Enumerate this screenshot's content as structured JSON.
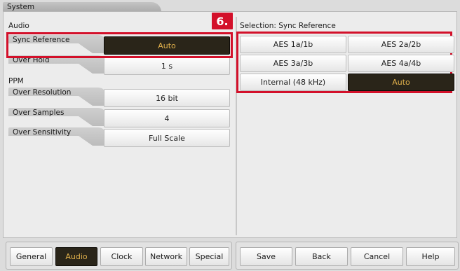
{
  "window": {
    "title": "System"
  },
  "left": {
    "audio_label": "Audio",
    "ppm_label": "PPM",
    "rows": [
      {
        "label": "Sync Reference",
        "value": "Auto",
        "active": true
      },
      {
        "label": "Over Hold",
        "value": "1 s"
      },
      {
        "label": "Over Resolution",
        "value": "16 bit"
      },
      {
        "label": "Over Samples",
        "value": "4"
      },
      {
        "label": "Over Sensitivity",
        "value": "Full Scale"
      }
    ]
  },
  "annotation": {
    "step": "6."
  },
  "right": {
    "selection_title": "Selection: Sync Reference",
    "options": [
      "AES 1a/1b",
      "AES 2a/2b",
      "AES 3a/3b",
      "AES 4a/4b",
      "Internal (48 kHz)",
      "Auto"
    ],
    "selected": "Auto"
  },
  "bottom": {
    "tabs": [
      "General",
      "Audio",
      "Clock",
      "Network",
      "Special"
    ],
    "active_tab": "Audio",
    "actions": [
      "Save",
      "Back",
      "Cancel",
      "Help"
    ]
  },
  "colors": {
    "accent_red": "#d3102a",
    "active_bg": "#2a2519",
    "active_text": "#e3b24c"
  }
}
